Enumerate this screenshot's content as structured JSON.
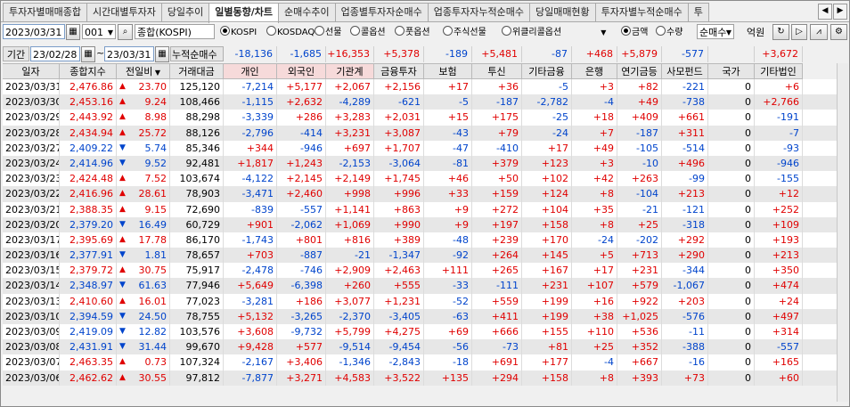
{
  "tabs": [
    "투자자별매매종합",
    "시간대별투자자",
    "당일추이",
    "일별동향/차트",
    "순매수추이",
    "업종별투자자순매수",
    "업종투자자누적순매수",
    "당일매매현황",
    "투자자별누적순매수",
    "투"
  ],
  "active_tab": 3,
  "toolbar": {
    "date": "2023/03/31",
    "code": "001",
    "index_name": "종합(KOSPI)",
    "markets": [
      "KOSPI",
      "KOSDAQ",
      "선물",
      "콜옵션",
      "풋옵션",
      "주식선물",
      "위클리콜옵션"
    ],
    "market_selected": 0,
    "unit_options": [
      "금액",
      "수량"
    ],
    "unit_selected": 0,
    "trade_type": "순매수",
    "money_unit": "억원"
  },
  "period": {
    "label": "기간",
    "from": "23/02/28",
    "sep": "~",
    "to": "23/03/31",
    "cum_label": "누적순매수"
  },
  "summary": [
    "-18,136",
    "-1,685",
    "+16,353",
    "+5,378",
    "-189",
    "+5,481",
    "-87",
    "+468",
    "+5,879",
    "-577",
    "",
    "+3,672"
  ],
  "headers": [
    "일자",
    "종합지수",
    "전일비",
    "거래대금",
    "개인",
    "외국인",
    "기관계",
    "금융투자",
    "보험",
    "투신",
    "기타금융",
    "은행",
    "연기금등",
    "사모펀드",
    "국가",
    "기타법인"
  ],
  "rows": [
    [
      "2023/03/31",
      "2,476.86",
      "up",
      "23.70",
      "125,120",
      "-7,214",
      "+5,177",
      "+2,067",
      "+2,156",
      "+17",
      "+36",
      "-5",
      "+3",
      "+82",
      "-221",
      "0",
      "+6"
    ],
    [
      "2023/03/30",
      "2,453.16",
      "up",
      "9.24",
      "108,466",
      "-1,115",
      "+2,632",
      "-4,289",
      "-621",
      "-5",
      "-187",
      "-2,782",
      "-4",
      "+49",
      "-738",
      "0",
      "+2,766"
    ],
    [
      "2023/03/29",
      "2,443.92",
      "up",
      "8.98",
      "88,298",
      "-3,339",
      "+286",
      "+3,283",
      "+2,031",
      "+15",
      "+175",
      "-25",
      "+18",
      "+409",
      "+661",
      "0",
      "-191"
    ],
    [
      "2023/03/28",
      "2,434.94",
      "up",
      "25.72",
      "88,126",
      "-2,796",
      "-414",
      "+3,231",
      "+3,087",
      "-43",
      "+79",
      "-24",
      "+7",
      "-187",
      "+311",
      "0",
      "-7"
    ],
    [
      "2023/03/27",
      "2,409.22",
      "dn",
      "5.74",
      "85,346",
      "+344",
      "-946",
      "+697",
      "+1,707",
      "-47",
      "-410",
      "+17",
      "+49",
      "-105",
      "-514",
      "0",
      "-93"
    ],
    [
      "2023/03/24",
      "2,414.96",
      "dn",
      "9.52",
      "92,481",
      "+1,817",
      "+1,243",
      "-2,153",
      "-3,064",
      "-81",
      "+379",
      "+123",
      "+3",
      "-10",
      "+496",
      "0",
      "-946"
    ],
    [
      "2023/03/23",
      "2,424.48",
      "up",
      "7.52",
      "103,674",
      "-4,122",
      "+2,145",
      "+2,149",
      "+1,745",
      "+46",
      "+50",
      "+102",
      "+42",
      "+263",
      "-99",
      "0",
      "-155"
    ],
    [
      "2023/03/22",
      "2,416.96",
      "up",
      "28.61",
      "78,903",
      "-3,471",
      "+2,460",
      "+998",
      "+996",
      "+33",
      "+159",
      "+124",
      "+8",
      "-104",
      "+213",
      "0",
      "+12"
    ],
    [
      "2023/03/21",
      "2,388.35",
      "up",
      "9.15",
      "72,690",
      "-839",
      "-557",
      "+1,141",
      "+863",
      "+9",
      "+272",
      "+104",
      "+35",
      "-21",
      "-121",
      "0",
      "+252"
    ],
    [
      "2023/03/20",
      "2,379.20",
      "dn",
      "16.49",
      "60,729",
      "+901",
      "-2,062",
      "+1,069",
      "+990",
      "+9",
      "+197",
      "+158",
      "+8",
      "+25",
      "-318",
      "0",
      "+109"
    ],
    [
      "2023/03/17",
      "2,395.69",
      "up",
      "17.78",
      "86,170",
      "-1,743",
      "+801",
      "+816",
      "+389",
      "-48",
      "+239",
      "+170",
      "-24",
      "-202",
      "+292",
      "0",
      "+193"
    ],
    [
      "2023/03/16",
      "2,377.91",
      "dn",
      "1.81",
      "78,657",
      "+703",
      "-887",
      "-21",
      "-1,347",
      "-92",
      "+264",
      "+145",
      "+5",
      "+713",
      "+290",
      "0",
      "+213"
    ],
    [
      "2023/03/15",
      "2,379.72",
      "up",
      "30.75",
      "75,917",
      "-2,478",
      "-746",
      "+2,909",
      "+2,463",
      "+111",
      "+265",
      "+167",
      "+17",
      "+231",
      "-344",
      "0",
      "+350"
    ],
    [
      "2023/03/14",
      "2,348.97",
      "dn",
      "61.63",
      "77,946",
      "+5,649",
      "-6,398",
      "+260",
      "+555",
      "-33",
      "-111",
      "+231",
      "+107",
      "+579",
      "-1,067",
      "0",
      "+474"
    ],
    [
      "2023/03/13",
      "2,410.60",
      "up",
      "16.01",
      "77,023",
      "-3,281",
      "+186",
      "+3,077",
      "+1,231",
      "-52",
      "+559",
      "+199",
      "+16",
      "+922",
      "+203",
      "0",
      "+24"
    ],
    [
      "2023/03/10",
      "2,394.59",
      "dn",
      "24.50",
      "78,755",
      "+5,132",
      "-3,265",
      "-2,370",
      "-3,405",
      "-63",
      "+411",
      "+199",
      "+38",
      "+1,025",
      "-576",
      "0",
      "+497"
    ],
    [
      "2023/03/09",
      "2,419.09",
      "dn",
      "12.82",
      "103,576",
      "+3,608",
      "-9,732",
      "+5,799",
      "+4,275",
      "+69",
      "+666",
      "+155",
      "+110",
      "+536",
      "-11",
      "0",
      "+314"
    ],
    [
      "2023/03/08",
      "2,431.91",
      "dn",
      "31.44",
      "99,670",
      "+9,428",
      "+577",
      "-9,514",
      "-9,454",
      "-56",
      "-73",
      "+81",
      "+25",
      "+352",
      "-388",
      "0",
      "-557"
    ],
    [
      "2023/03/07",
      "2,463.35",
      "up",
      "0.73",
      "107,324",
      "-2,167",
      "+3,406",
      "-1,346",
      "-2,843",
      "-18",
      "+691",
      "+177",
      "-4",
      "+667",
      "-16",
      "0",
      "+165"
    ],
    [
      "2023/03/06",
      "2,462.62",
      "up",
      "30.55",
      "97,812",
      "-7,877",
      "+3,271",
      "+4,583",
      "+3,522",
      "+135",
      "+294",
      "+158",
      "+8",
      "+393",
      "+73",
      "0",
      "+60"
    ]
  ],
  "colors": {
    "up": "#e00000",
    "down": "#0044cc",
    "header_pink": "#f6dada",
    "header_grey": "#e6e6e6",
    "row_alt": "#e7e7e7"
  },
  "icons": [
    "calendar-icon",
    "search-icon",
    "refresh-icon",
    "chart-icon",
    "settings-icon",
    "tab-prev-icon",
    "tab-next-icon",
    "sort-arrow-icon"
  ]
}
